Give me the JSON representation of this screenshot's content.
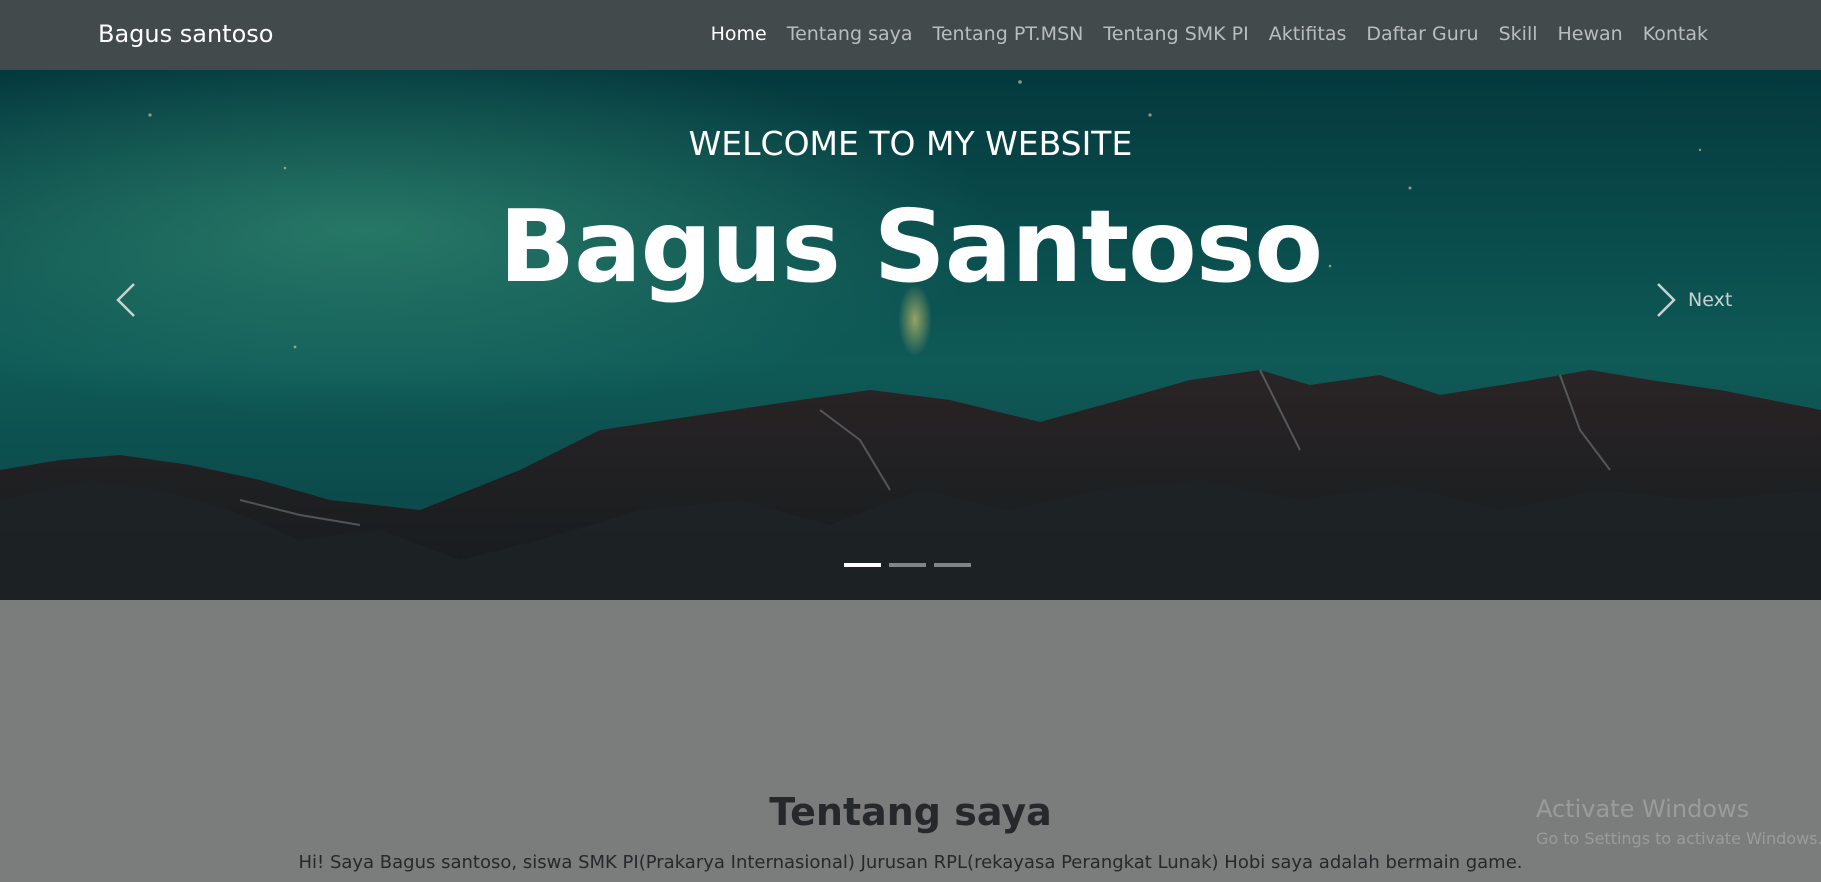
{
  "navbar": {
    "brand": "Bagus santoso",
    "items": [
      {
        "label": "Home"
      },
      {
        "label": "Tentang saya"
      },
      {
        "label": "Tentang PT.MSN"
      },
      {
        "label": "Tentang SMK PI"
      },
      {
        "label": "Aktifitas"
      },
      {
        "label": "Daftar Guru"
      },
      {
        "label": "Skill"
      },
      {
        "label": "Hewan"
      },
      {
        "label": "Kontak"
      }
    ]
  },
  "hero": {
    "welcome": "WELCOME TO MY WEBSITE",
    "title": "Bagus Santoso",
    "next_label": "Next",
    "slide_count": 3,
    "active_slide": 1
  },
  "about": {
    "title": "Tentang saya",
    "text": "Hi! Saya Bagus santoso, siswa SMK PI(Prakarya Internasional) Jurusan RPL(rekayasa Perangkat Lunak) Hobi saya adalah bermain game."
  },
  "watermark": {
    "title": "Activate Windows",
    "subtitle": "Go to Settings to activate Windows."
  },
  "colors": {
    "navbar": "#434a4b",
    "page_background": "#7b7d7c",
    "sky_top": "#04393e",
    "sky_mid": "#0e5a57"
  }
}
